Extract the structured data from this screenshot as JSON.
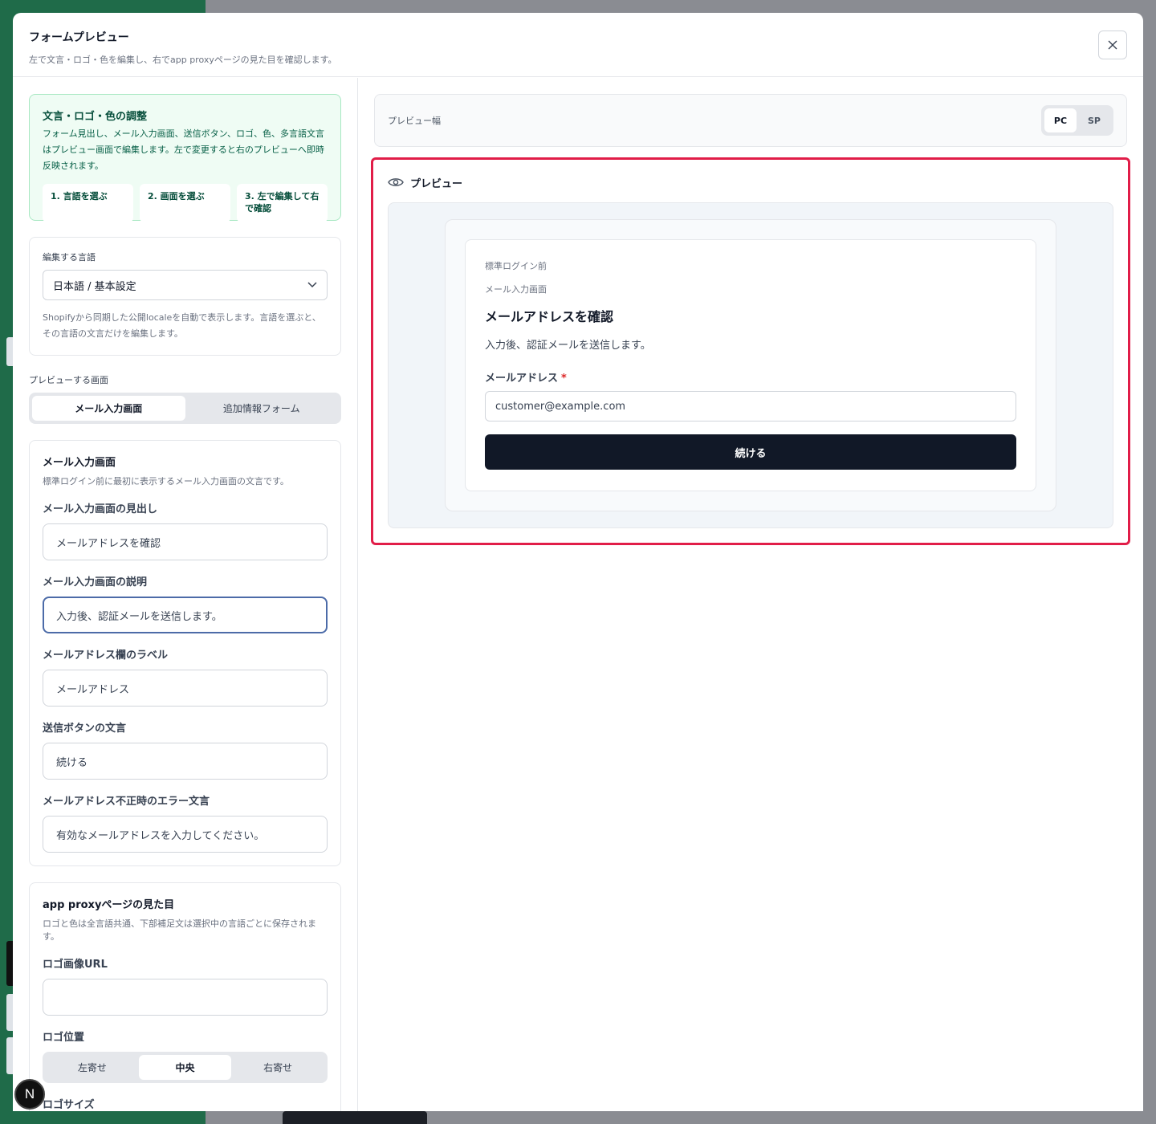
{
  "modal": {
    "title": "フォームプレビュー",
    "subtitle": "左で文言・ロゴ・色を編集し、右でapp proxyページの見た目を確認します。",
    "close_icon": "close-icon"
  },
  "tips": {
    "title": "文言・ロゴ・色の調整",
    "body": "フォーム見出し、メール入力画面、送信ボタン、ロゴ、色、多言語文言はプレビュー画面で編集します。左で変更すると右のプレビューへ即時反映されます。",
    "steps": [
      "1. 言語を選ぶ",
      "2. 画面を選ぶ",
      "3. 左で編集して右で確認"
    ]
  },
  "language": {
    "caption": "編集する言語",
    "selected": "日本語 / 基本設定",
    "help": "Shopifyから同期した公開localeを自動で表示します。言語を選ぶと、その言語の文言だけを編集します。"
  },
  "screen": {
    "caption": "プレビューする画面",
    "options": [
      "メール入力画面",
      "追加情報フォーム"
    ],
    "active": 0
  },
  "email_screen": {
    "title": "メール入力画面",
    "desc": "標準ログイン前に最初に表示するメール入力画面の文言です。",
    "fields": [
      {
        "label": "メール入力画面の見出し",
        "value": "メールアドレスを確認"
      },
      {
        "label": "メール入力画面の説明",
        "value": "入力後、認証メールを送信します。"
      },
      {
        "label": "メールアドレス欄のラベル",
        "value": "メールアドレス"
      },
      {
        "label": "送信ボタンの文言",
        "value": "続ける"
      },
      {
        "label": "メールアドレス不正時のエラー文言",
        "value": "有効なメールアドレスを入力してください。"
      }
    ]
  },
  "appearance": {
    "title": "app proxyページの見た目",
    "desc": "ロゴと色は全言語共通、下部補足文は選択中の言語ごとに保存されます。",
    "logo_url_label": "ロゴ画像URL",
    "logo_url_value": "",
    "logo_position_label": "ロゴ位置",
    "logo_positions": [
      "左寄せ",
      "中央",
      "右寄せ"
    ],
    "logo_position_active": 1,
    "logo_size_label": "ロゴサイズ"
  },
  "preview": {
    "width_label": "プレビュー幅",
    "width_options": [
      "PC",
      "SP"
    ],
    "width_active": 0,
    "title": "プレビュー",
    "kicker": "標準ログイン前",
    "step": "メール入力画面",
    "heading": "メールアドレスを確認",
    "desc": "入力後、認証メールを送信します。",
    "email_label": "メールアドレス",
    "required_mark": "*",
    "email_value": "customer@example.com",
    "button": "続ける"
  },
  "badge": {
    "letter": "N"
  },
  "colors": {
    "accent_red": "#e11d48",
    "primary": "#111827",
    "tip_bg": "#effcf4"
  }
}
